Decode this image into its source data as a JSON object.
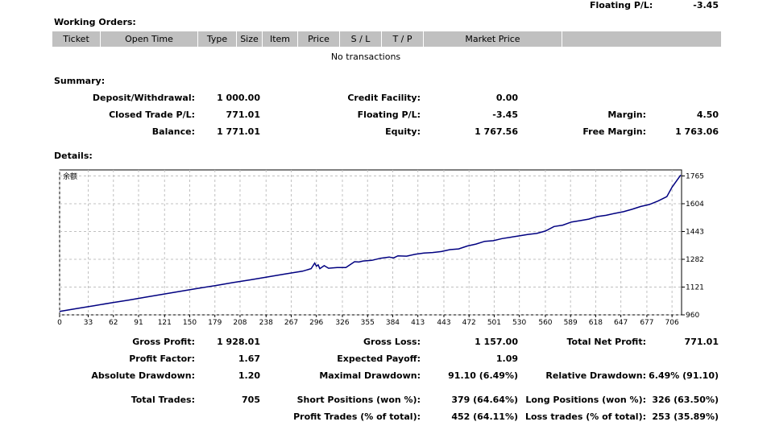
{
  "top": {
    "floating_label": "Floating P/L:",
    "floating_value": "-3.45"
  },
  "working_orders": {
    "title": "Working Orders:",
    "columns": [
      "Ticket",
      "Open Time",
      "Type",
      "Size",
      "Item",
      "Price",
      "S / L",
      "T / P",
      "Market Price",
      ""
    ],
    "empty_text": "No transactions"
  },
  "summary": {
    "title": "Summary:",
    "deposit_label": "Deposit/Withdrawal:",
    "deposit_value": "1 000.00",
    "credit_label": "Credit Facility:",
    "credit_value": "0.00",
    "closed_label": "Closed Trade P/L:",
    "closed_value": "771.01",
    "floating_label": "Floating P/L:",
    "floating_value": "-3.45",
    "margin_label": "Margin:",
    "margin_value": "4.50",
    "balance_label": "Balance:",
    "balance_value": "1 771.01",
    "equity_label": "Equity:",
    "equity_value": "1 767.56",
    "free_margin_label": "Free Margin:",
    "free_margin_value": "1 763.06"
  },
  "details": {
    "title": "Details:",
    "gross_profit_label": "Gross Profit:",
    "gross_profit_value": "1 928.01",
    "gross_loss_label": "Gross Loss:",
    "gross_loss_value": "1 157.00",
    "total_net_label": "Total Net Profit:",
    "total_net_value": "771.01",
    "profit_factor_label": "Profit Factor:",
    "profit_factor_value": "1.67",
    "expected_payoff_label": "Expected Payoff:",
    "expected_payoff_value": "1.09",
    "abs_dd_label": "Absolute Drawdown:",
    "abs_dd_value": "1.20",
    "max_dd_label": "Maximal Drawdown:",
    "max_dd_value": "91.10 (6.49%)",
    "rel_dd_label": "Relative Drawdown:",
    "rel_dd_value": "6.49% (91.10)",
    "total_trades_label": "Total Trades:",
    "total_trades_value": "705",
    "short_label": "Short Positions (won %):",
    "short_value": "379 (64.64%)",
    "long_label": "Long Positions (won %):",
    "long_value": "326 (63.50%)",
    "profit_trades_label": "Profit Trades (% of total):",
    "profit_trades_value": "452 (64.11%)",
    "loss_trades_label": "Loss trades (% of total):",
    "loss_trades_value": "253 (35.89%)"
  },
  "chart_data": {
    "type": "line",
    "title": "",
    "legend_text": "余额",
    "line_color": "#000080",
    "grid": true,
    "xlim": [
      0,
      717
    ],
    "ylim": [
      960,
      1800
    ],
    "x_ticks": [
      0,
      33,
      62,
      91,
      121,
      150,
      179,
      208,
      238,
      267,
      296,
      326,
      355,
      384,
      413,
      443,
      472,
      501,
      530,
      560,
      589,
      618,
      647,
      677,
      706
    ],
    "y_ticks": [
      960,
      1121,
      1282,
      1443,
      1604,
      1765
    ],
    "series": [
      {
        "x": [
          0,
          20,
          40,
          60,
          80,
          100,
          120,
          140,
          160,
          180,
          200,
          220,
          240,
          260,
          280,
          290,
          294,
          296,
          298,
          300,
          305,
          310,
          320,
          330,
          340,
          345,
          350,
          360,
          370,
          380,
          385,
          390,
          400,
          410,
          420,
          430,
          440,
          450,
          460,
          470,
          480,
          490,
          500,
          510,
          520,
          530,
          540,
          550,
          560,
          570,
          580,
          590,
          600,
          610,
          620,
          630,
          640,
          650,
          660,
          670,
          680,
          690,
          700,
          706,
          716
        ],
        "y": [
          980,
          997,
          1013,
          1030,
          1046,
          1063,
          1080,
          1097,
          1114,
          1130,
          1147,
          1163,
          1180,
          1197,
          1213,
          1228,
          1260,
          1242,
          1250,
          1228,
          1245,
          1230,
          1234,
          1234,
          1268,
          1266,
          1272,
          1276,
          1288,
          1295,
          1290,
          1302,
          1300,
          1311,
          1318,
          1321,
          1327,
          1338,
          1342,
          1359,
          1370,
          1386,
          1390,
          1402,
          1410,
          1418,
          1426,
          1432,
          1446,
          1472,
          1480,
          1498,
          1506,
          1515,
          1530,
          1537,
          1548,
          1558,
          1572,
          1588,
          1600,
          1620,
          1645,
          1700,
          1770
        ]
      }
    ]
  }
}
